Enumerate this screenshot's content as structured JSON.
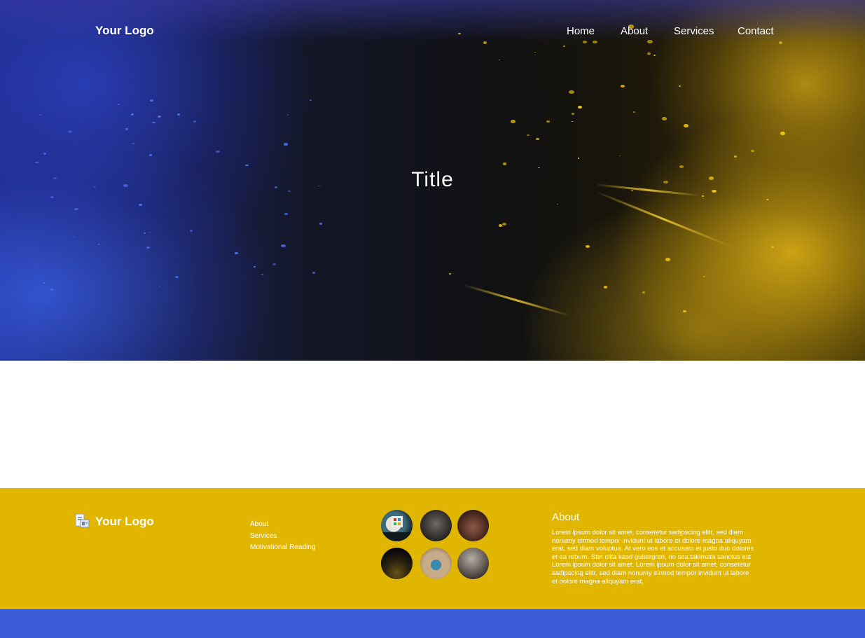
{
  "header": {
    "logo": "Your Logo",
    "nav": [
      "Home",
      "About",
      "Services",
      "Contact"
    ]
  },
  "hero": {
    "title": "Title"
  },
  "footer": {
    "logo": "Your Logo",
    "links": [
      "About",
      "Services",
      "Motivational Reading"
    ],
    "gallery": [
      {
        "name": "gallery-photo-presentation"
      },
      {
        "name": "gallery-photo-audience"
      },
      {
        "name": "gallery-photo-crowd"
      },
      {
        "name": "gallery-photo-dark-hall"
      },
      {
        "name": "gallery-photo-speaker"
      },
      {
        "name": "gallery-photo-auditorium"
      }
    ],
    "about_heading": "About",
    "about_text": "Lorem ipsum dolor sit amet, consetetur sadipscing elitr, sed diam nonumy eirmod tempor invidunt ut labore et dolore magna aliquyam erat, sed diam voluptua. At vero eos et accusam et justo duo dolores et ea rebum. Stet clita kasd gubergren, no sea takimata sanctus est Lorem ipsum dolor sit amet. Lorem ipsum dolor sit amet, consetetur sadipscing elitr, sed diam nonumy eirmod tempor invidunt ut labore et dolore magna aliquyam erat,"
  },
  "colors": {
    "footer_bg": "#e1b600",
    "bottom_bar": "#3a5ad6",
    "hero_blue": "#2a40be",
    "hero_gold": "#e2b414"
  }
}
